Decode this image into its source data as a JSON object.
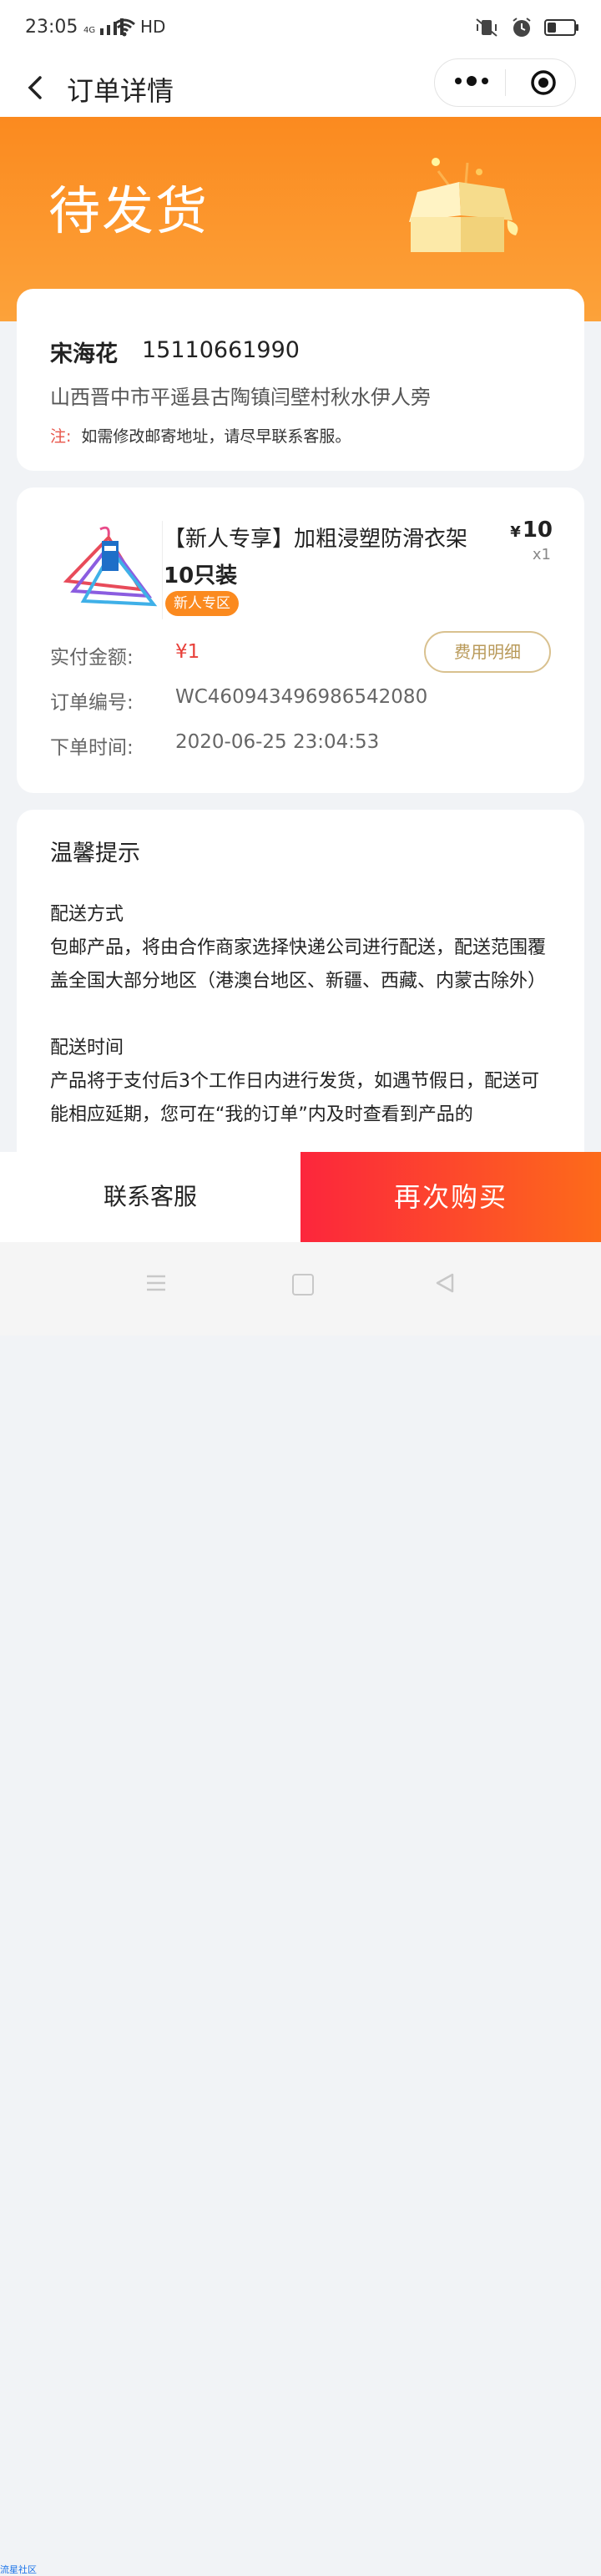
{
  "status_bar": {
    "time": "23:05",
    "network": "4G",
    "hd": "HD",
    "icons": [
      "signal-icon",
      "wifi-icon",
      "mute-vibrate-icon",
      "alarm-icon",
      "battery-icon"
    ]
  },
  "nav": {
    "title": "订单详情",
    "back_icon": "chevron-left-icon",
    "more_icon": "more-dots-icon",
    "close_icon": "target-circle-icon"
  },
  "hero": {
    "status": "待发货",
    "illustration": "open-box-icon",
    "colors": {
      "from": "#fb8a1f",
      "to": "#fca23a"
    }
  },
  "address": {
    "name": "宋海花",
    "phone": "15110661990",
    "line": "山西晋中市平遥县古陶镇闫壁村秋水伊人旁",
    "note_label": "注:",
    "note_text": "如需修改邮寄地址，请尽早联系客服。"
  },
  "order": {
    "product_title": "【新人专享】加粗浸塑防滑衣架",
    "product_qty_text": "10只装",
    "price_symbol": "¥",
    "price": "10",
    "count": "x1",
    "tag": "新人专区",
    "paid_label": "实付金额:",
    "paid_value": "¥1",
    "fee_button": "费用明细",
    "order_no_label": "订单编号:",
    "order_no": "WC460943496986542080",
    "order_time_label": "下单时间:",
    "order_time": "2020-06-25 23:04:53"
  },
  "tips": {
    "title": "温馨提示",
    "delivery_method_title": "配送方式",
    "delivery_method_text": "包邮产品，将由合作商家选择快递公司进行配送，配送范围覆盖全国大部分地区（港澳台地区、新疆、西藏、内蒙古除外）",
    "delivery_time_title": "配送时间",
    "delivery_time_text": "产品将于支付后3个工作日内进行发货，如遇节假日，配送可能相应延期，您可在“我的订单”内及时查看到产品的"
  },
  "actions": {
    "contact": "联系客服",
    "buy_again": "再次购买"
  },
  "watermark": "流星社区",
  "colors": {
    "accent": "#fb8a1f",
    "price_red": "#e8403a",
    "buy_gradient_from": "#fc263c",
    "buy_gradient_to": "#fd6b1a",
    "fee_border": "#d9c18f"
  }
}
